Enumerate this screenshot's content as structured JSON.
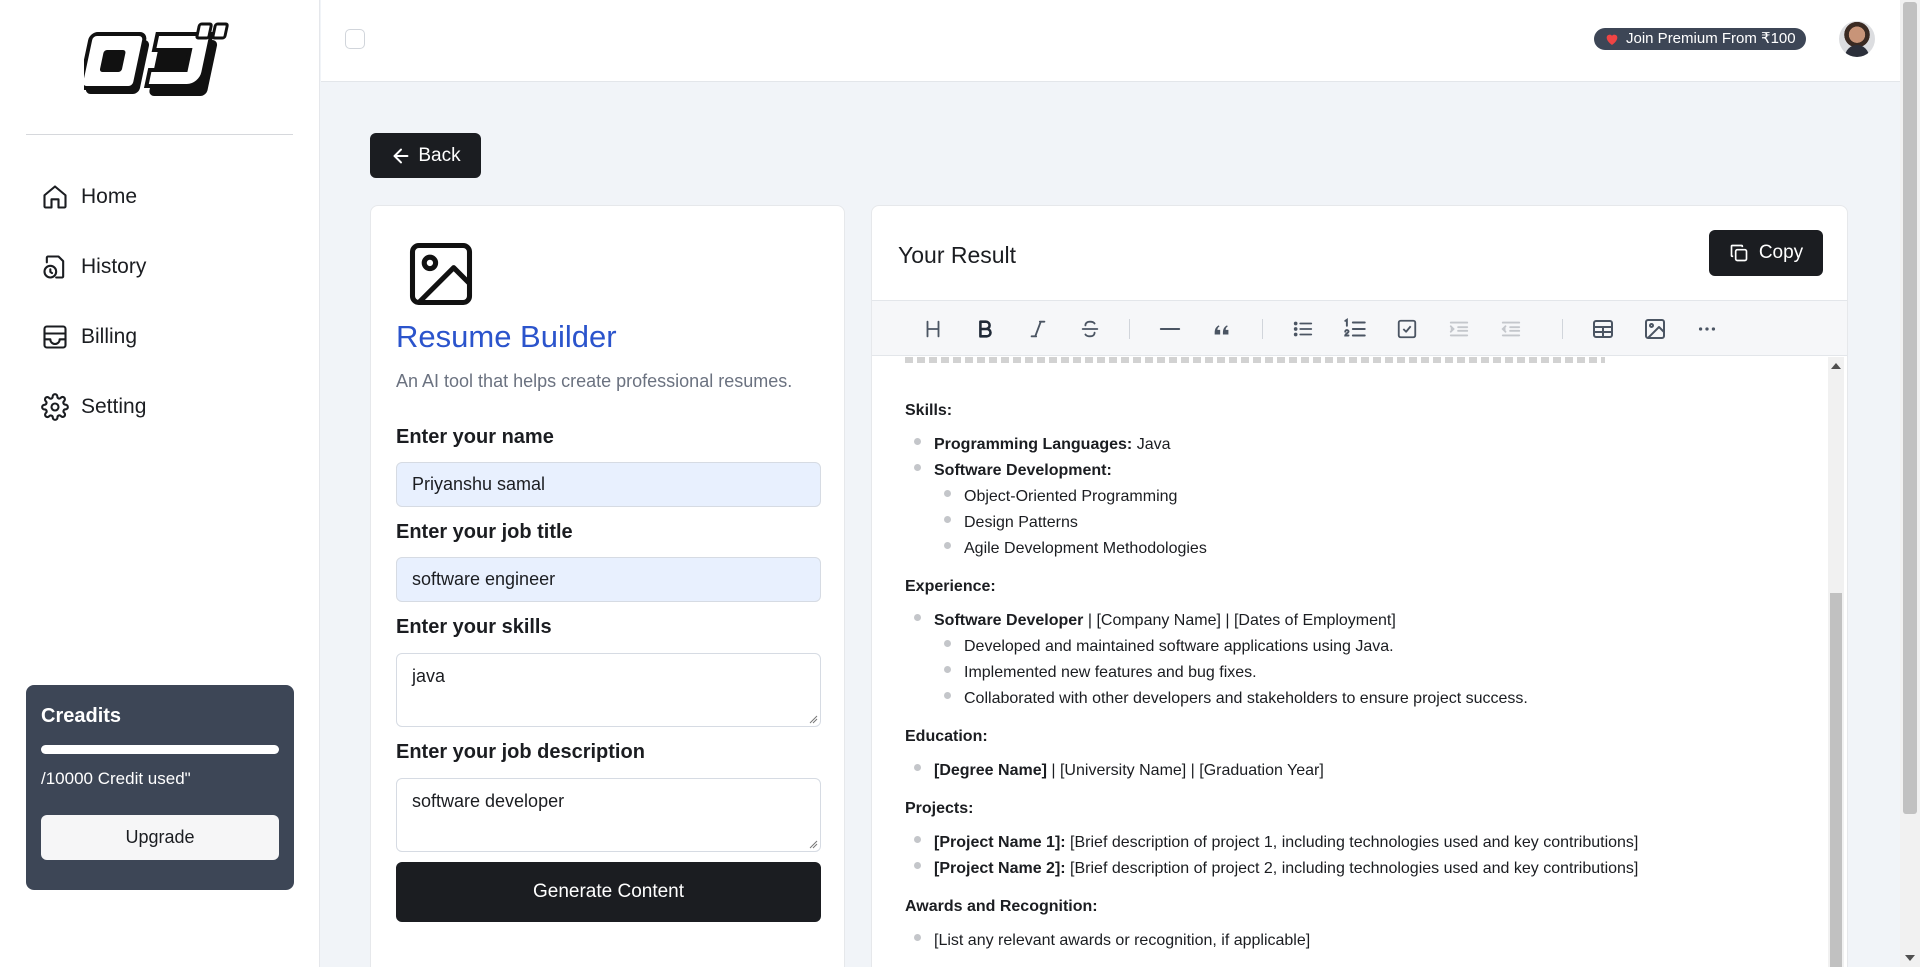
{
  "sidebar": {
    "logo_text": "OJ",
    "items": [
      {
        "label": "Home",
        "icon": "home-icon"
      },
      {
        "label": "History",
        "icon": "history-icon"
      },
      {
        "label": "Billing",
        "icon": "billing-icon"
      },
      {
        "label": "Setting",
        "icon": "gear-icon"
      }
    ],
    "credits": {
      "title": "Creadits",
      "used_text": "/10000 Credit used\"",
      "upgrade_label": "Upgrade"
    }
  },
  "topbar": {
    "premium_label": "Join Premium From ₹100"
  },
  "back_label": "Back",
  "form": {
    "title": "Resume Builder",
    "description": "An AI tool that helps create professional resumes.",
    "name_label": "Enter your name",
    "name_value": "Priyanshu samal",
    "job_title_label": "Enter your job title",
    "job_title_value": "software engineer",
    "skills_label": "Enter your skills",
    "skills_value": "java",
    "job_desc_label": "Enter your job description",
    "job_desc_value": "software developer",
    "generate_label": "Generate Content"
  },
  "result": {
    "title": "Your Result",
    "copy_label": "Copy",
    "toolbar": [
      "heading-icon",
      "bold-icon",
      "italic-icon",
      "strike-icon",
      "hr-icon",
      "quote-icon",
      "bullet-list-icon",
      "ordered-list-icon",
      "task-list-icon",
      "indent-icon",
      "outdent-icon",
      "table-icon",
      "image-icon",
      "more-icon"
    ],
    "content": {
      "skills_heading": "Skills:",
      "skill1_bold": "Programming Languages:",
      "skill1_text": " Java",
      "skill2_bold": "Software Development:",
      "skill2_sub": [
        "Object-Oriented Programming",
        "Design Patterns",
        "Agile Development Methodologies"
      ],
      "experience_heading": "Experience:",
      "exp1_bold": "Software Developer",
      "exp1_text": " | [Company Name] | [Dates of Employment]",
      "exp1_sub": [
        "Developed and maintained software applications using Java.",
        "Implemented new features and bug fixes.",
        "Collaborated with other developers and stakeholders to ensure project success."
      ],
      "education_heading": "Education:",
      "edu1_bold": "[Degree Name]",
      "edu1_text": " | [University Name] | [Graduation Year]",
      "projects_heading": "Projects:",
      "proj1_bold": "[Project Name 1]:",
      "proj1_text": " [Brief description of project 1, including technologies used and key contributions]",
      "proj2_bold": "[Project Name 2]:",
      "proj2_text": " [Brief description of project 2, including technologies used and key contributions]",
      "awards_heading": "Awards and Recognition:",
      "award1_text": "[List any relevant awards or recognition, if applicable]"
    }
  }
}
